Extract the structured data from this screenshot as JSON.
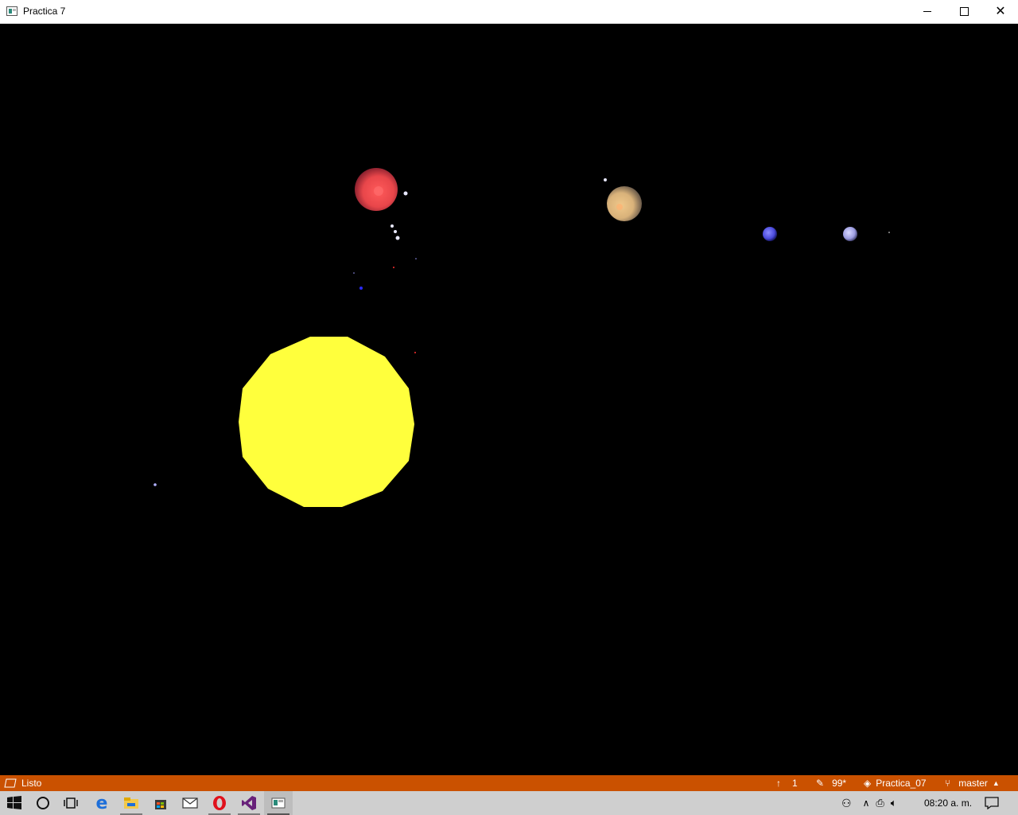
{
  "window": {
    "title": "Practica 7"
  },
  "statusbar": {
    "status": "Listo",
    "pending_pushes": "1",
    "pending_changes": "99*",
    "repository": "Practica_07",
    "branch": "master",
    "background_color": "#CA5100"
  },
  "scene": {
    "background_color": "#000000",
    "sun_color": "#FFFF3C",
    "bodies": [
      {
        "name": "sun",
        "color": "#FFFF3C"
      },
      {
        "name": "red planet",
        "color": "#E8464A"
      },
      {
        "name": "tan planet",
        "color": "#D9B27A"
      },
      {
        "name": "blue planet",
        "color": "#4A4ADC"
      },
      {
        "name": "lavender planet",
        "color": "#9C9CE0"
      }
    ]
  },
  "taskbar": {
    "clock": "08:20 a. m.",
    "pinned": [
      "windows-start",
      "cortana-search",
      "task-view",
      "edge",
      "file-explorer",
      "store",
      "mail",
      "opera",
      "visual-studio",
      "practica-7-app"
    ]
  }
}
